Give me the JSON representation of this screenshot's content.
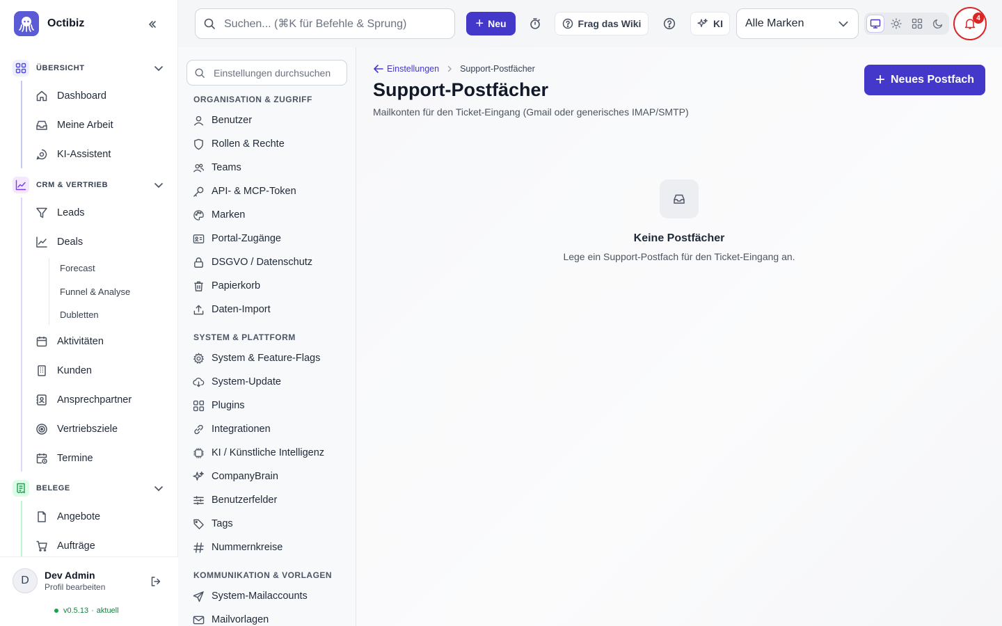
{
  "app": {
    "name": "Octibiz",
    "version": "v0.5.13",
    "version_status": "aktuell"
  },
  "topbar": {
    "search_placeholder": "Suchen... (⌘K für Befehle & Sprung)",
    "new_label": "Neu",
    "wiki_label": "Frag das Wiki",
    "ai_label": "KI",
    "brand_select": "Alle Marken",
    "notifications_count": "4"
  },
  "sidebar": {
    "sections": [
      {
        "label": "ÜBERSICHT",
        "color": "#4f46e5"
      },
      {
        "label": "CRM & VERTRIEB",
        "color": "#7c3aed"
      },
      {
        "label": "BELEGE",
        "color": "#16a34a"
      }
    ],
    "overview_items": [
      "Dashboard",
      "Meine Arbeit",
      "KI-Assistent"
    ],
    "crm_items": [
      "Leads",
      "Deals"
    ],
    "deals_sub": [
      "Forecast",
      "Funnel & Analyse",
      "Dubletten"
    ],
    "crm_items_2": [
      "Aktivitäten",
      "Kunden",
      "Ansprechpartner",
      "Vertriebsziele",
      "Termine"
    ],
    "belege_items": [
      "Angebote",
      "Aufträge"
    ]
  },
  "user": {
    "initial": "D",
    "name": "Dev Admin",
    "profile": "Profil bearbeiten"
  },
  "settings_nav": {
    "search_placeholder": "Einstellungen durchsuchen",
    "groups": [
      {
        "title": "ORGANISATION & ZUGRIFF",
        "items": [
          "Benutzer",
          "Rollen & Rechte",
          "Teams",
          "API- & MCP-Token",
          "Marken",
          "Portal-Zugänge",
          "DSGVO / Datenschutz",
          "Papierkorb",
          "Daten-Import"
        ]
      },
      {
        "title": "SYSTEM & PLATTFORM",
        "items": [
          "System & Feature-Flags",
          "System-Update",
          "Plugins",
          "Integrationen",
          "KI / Künstliche Intelligenz",
          "CompanyBrain",
          "Benutzerfelder",
          "Tags",
          "Nummernkreise"
        ]
      },
      {
        "title": "KOMMUNIKATION & VORLAGEN",
        "items": [
          "System-Mailaccounts",
          "Mailvorlagen"
        ]
      }
    ]
  },
  "page": {
    "breadcrumb_back": "Einstellungen",
    "breadcrumb_current": "Support-Postfächer",
    "title": "Support-Postfächer",
    "subtitle": "Mailkonten für den Ticket-Eingang (Gmail oder generisches IMAP/SMTP)",
    "primary_button": "Neues Postfach",
    "empty_title": "Keine Postfächer",
    "empty_text": "Lege ein Support-Postfach für den Ticket-Eingang an."
  },
  "colors": {
    "primary": "#4338ca",
    "danger": "#dc2626",
    "success": "#16a34a"
  }
}
